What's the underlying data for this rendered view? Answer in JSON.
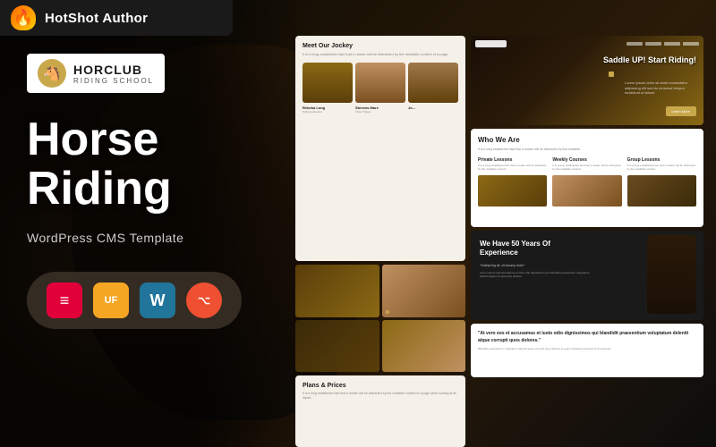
{
  "topbar": {
    "brand_name": "HotShot Author",
    "flame_icon": "flame-icon"
  },
  "left": {
    "logo_main": "HORCLUB",
    "logo_sub": "RIDING SCHOOL",
    "heading_line1": "Horse",
    "heading_line2": "Riding",
    "subtitle": "WordPress CMS Template",
    "tech_icons": [
      {
        "name": "Elementor",
        "symbol": "≡",
        "type": "elementor"
      },
      {
        "name": "UX Fusion",
        "symbol": "UF",
        "type": "uiux"
      },
      {
        "name": "WordPress",
        "symbol": "W",
        "type": "wordpress"
      },
      {
        "name": "Git",
        "symbol": "⌥",
        "type": "git"
      }
    ]
  },
  "preview": {
    "hero": {
      "headline": "Saddle UP!\nStart Riding!",
      "button": "Learn More"
    },
    "jockey": {
      "title": "Meet Our Jockey",
      "desc": "It is a long established fact that a reader will be distracted by the readable content of a page",
      "people": [
        {
          "name": "Rebeka Long",
          "role": "Riding Instructor"
        },
        {
          "name": "Stevens Mare",
          "role": "Show Trainer"
        },
        {
          "name": "Jo...",
          "role": "..."
        }
      ]
    },
    "who": {
      "title": "Who We Are",
      "desc": "It is a long established fact that a reader will be distracted by the readable.",
      "lessons": [
        {
          "title": "Private Lessons",
          "desc": "It is a long established fact that a reader will be distracted by the readable content."
        },
        {
          "title": "Weekly Courses",
          "desc": "It is a long established fact that a reader will be distracted by the readable content."
        },
        {
          "title": "Group Lessons",
          "desc": "It is a long established fact that a reader will be distracted by the readable content."
        }
      ]
    },
    "experience": {
      "title": "We Have 50 Years Of Experience",
      "quote": "\"Gallopcing sit, sit dummy dolor\"",
      "text": "Lorem ipsum and accusamus et iusto odio dignissimos qui blandidit praesentium voluptatum deleniti atque corrupti quos dolores."
    },
    "plans": {
      "title": "Plans & Prices",
      "desc": "It is a long established fact that a reader will be distracted by the readable content of a page when looking at its layout."
    },
    "quote": {
      "text": "\"At vero eos et accusamus et iusto odio dignissimos qui blandidit praesentium voluptatum deleniti atque corrupti quos dolores.\"",
      "small": "Blandidit praesentium voluptatum deleniti atque corrupti quos dolores et quas molestias excepturi sint occaecati."
    }
  }
}
